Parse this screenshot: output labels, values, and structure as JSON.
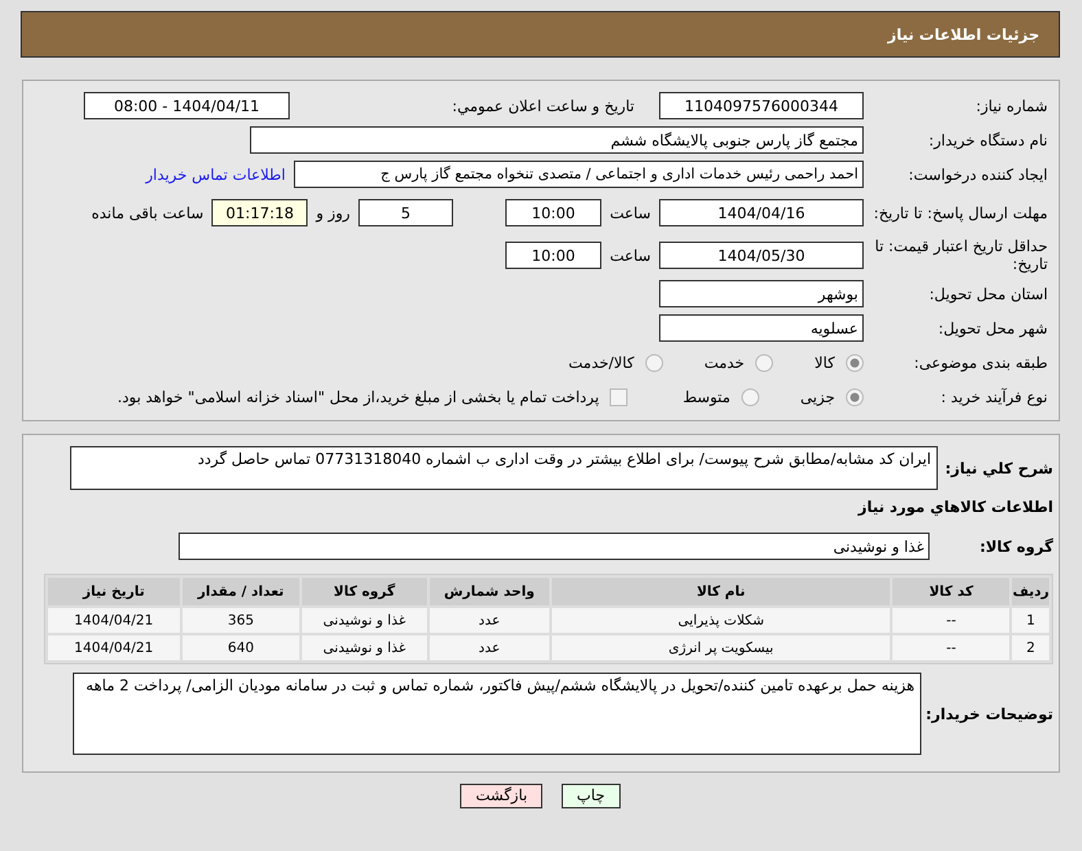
{
  "header": {
    "title": "جزئیات اطلاعات نیاز"
  },
  "need_number": {
    "label": "شماره نیاز:",
    "value": "1104097576000344"
  },
  "announce": {
    "label": "تاریخ و ساعت اعلان عمومي:",
    "value": "1404/04/11 - 08:00"
  },
  "buyer_org": {
    "label": "نام دستگاه خریدار:",
    "value": "مجتمع گاز پارس جنوبی  پالایشگاه ششم"
  },
  "requester": {
    "label": "ایجاد کننده درخواست:",
    "value": "احمد راحمی رئیس خدمات اداری و اجتماعی / متصدی تنخواه مجتمع گاز پارس ج",
    "link": "اطلاعات تماس خریدار"
  },
  "deadline": {
    "label": "مهلت ارسال پاسخ: تا تاریخ:",
    "date": "1404/04/16",
    "time_label": "ساعت",
    "time": "10:00",
    "days": "5",
    "days_label": "روز و",
    "remaining": "01:17:18",
    "remaining_label": "ساعت باقی مانده"
  },
  "validity": {
    "label": "حداقل تاریخ اعتبار قیمت: تا تاریخ:",
    "date": "1404/05/30",
    "time_label": "ساعت",
    "time": "10:00"
  },
  "province": {
    "label": "استان محل تحویل:",
    "value": "بوشهر"
  },
  "city": {
    "label": "شهر محل تحویل:",
    "value": "عسلویه"
  },
  "category": {
    "label": "طبقه بندی موضوعی:",
    "options": [
      {
        "label": "کالا",
        "selected": true
      },
      {
        "label": "خدمت",
        "selected": false
      },
      {
        "label": "کالا/خدمت",
        "selected": false
      }
    ]
  },
  "process": {
    "label": "نوع فرآیند خرید :",
    "options": [
      {
        "label": "جزیی",
        "selected": true
      },
      {
        "label": "متوسط",
        "selected": false
      }
    ],
    "treasury": {
      "checked": false,
      "label": "پرداخت تمام یا بخشی از مبلغ خرید،از محل \"اسناد خزانه اسلامی\" خواهد بود."
    }
  },
  "description": {
    "label": "شرح کلي نیاز:",
    "value": "ایران کد مشابه/مطابق شرح پیوست/ برای اطلاع بیشتر در وقت اداری ب اشماره 07731318040 تماس حاصل گردد"
  },
  "goods_heading": "اطلاعات کالاهاي مورد نیاز",
  "goods_group": {
    "label": "گروه کالا:",
    "value": "غذا و نوشیدنی"
  },
  "table": {
    "columns": [
      "ردیف",
      "کد کالا",
      "نام کالا",
      "واحد شمارش",
      "گروه کالا",
      "تعداد / مقدار",
      "تاریخ نیاز"
    ],
    "rows": [
      [
        "1",
        "--",
        "شکلات پذیرایی",
        "عدد",
        "غذا و نوشیدنی",
        "365",
        "1404/04/21"
      ],
      [
        "2",
        "--",
        "بیسکویت پر انرژی",
        "عدد",
        "غذا و نوشیدنی",
        "640",
        "1404/04/21"
      ]
    ]
  },
  "buyer_notes": {
    "label": "توضیحات خریدار:",
    "value": "هزینه حمل برعهده تامین کننده/تحویل در پالایشگاه ششم/پیش فاکتور، شماره تماس و ثبت در سامانه مودیان الزامی/ پرداخت 2 ماهه"
  },
  "buttons": [
    {
      "kind": "print",
      "label": "چاپ"
    },
    {
      "kind": "back",
      "label": "بازگشت"
    }
  ]
}
